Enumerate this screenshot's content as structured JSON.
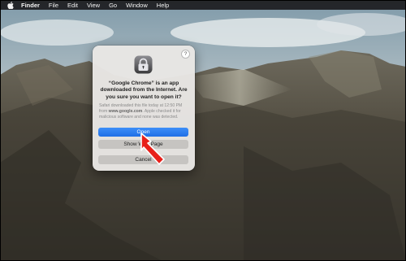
{
  "menubar": {
    "apple_icon": "apple-logo",
    "items": [
      "Finder",
      "File",
      "Edit",
      "View",
      "Go",
      "Window",
      "Help"
    ]
  },
  "dialog": {
    "help_label": "?",
    "app_icon": "gatekeeper-warning-icon",
    "title": "“Google Chrome” is an app downloaded from the Internet. Are you sure you want to open it?",
    "info_prefix": "Safari downloaded this file today at 12:50 PM from ",
    "info_source": "www.google.com",
    "info_suffix": ". Apple checked it for malicious software and none was detected.",
    "buttons": {
      "open": "Open",
      "show": "Show Web Page",
      "cancel": "Cancel"
    }
  },
  "annotation": {
    "arrow_color": "#e8201a"
  },
  "colors": {
    "accent": "#1f6fe6"
  }
}
